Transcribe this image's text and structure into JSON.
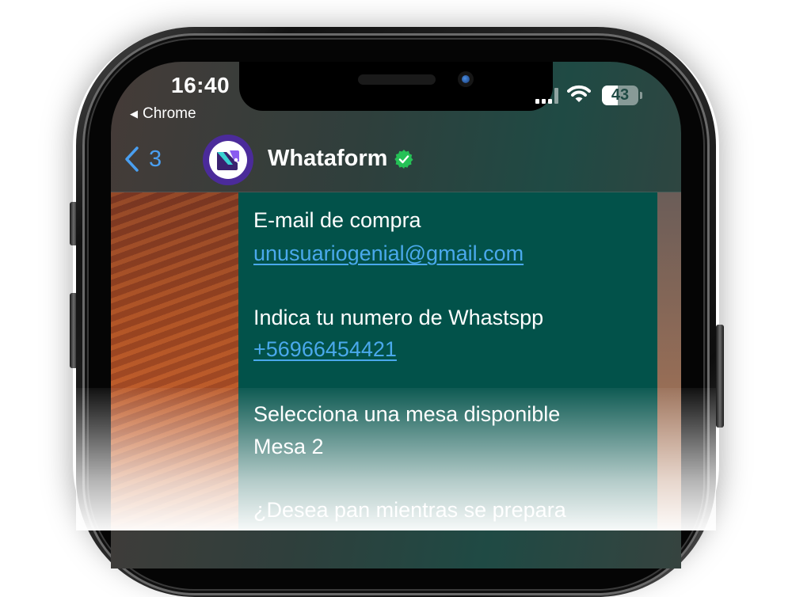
{
  "status_bar": {
    "time": "16:40",
    "back_app": "Chrome",
    "battery_level": "43",
    "battery_fraction": 0.43
  },
  "chat_header": {
    "back_count": "3",
    "contact_name": "Whataform",
    "verified": true,
    "colors": {
      "accent": "#4a9ff0",
      "verified": "#25c156",
      "avatar_ring": "#4b2b9a"
    }
  },
  "message": {
    "bubble_color": "#02524a",
    "link_color": "#4aa9ec",
    "fields": [
      {
        "label": "E-mail de compra",
        "value": "unusuariogenial@gmail.com",
        "is_link": true
      },
      {
        "label": "Indica tu numero de Whastspp",
        "value": "+56966454421",
        "is_link": true
      },
      {
        "label": "Selecciona una mesa disponible",
        "value": "Mesa 2",
        "is_link": false
      },
      {
        "label": "¿Desea pan mientras se prepara",
        "value": "",
        "is_link": false
      }
    ]
  }
}
